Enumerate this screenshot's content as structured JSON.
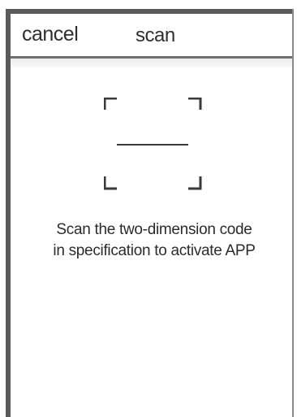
{
  "header": {
    "cancel_label": "cancel",
    "title": "scan"
  },
  "scanner": {
    "frame_icon": "scan-frame-corners-icon",
    "scan_line_icon": "scan-line-icon"
  },
  "instruction": {
    "line1": "Scan the two-dimension code",
    "line2": "in specification to activate APP"
  },
  "colors": {
    "border": "#5a5a5a",
    "text": "#2b2b2b",
    "background": "#ffffff"
  }
}
